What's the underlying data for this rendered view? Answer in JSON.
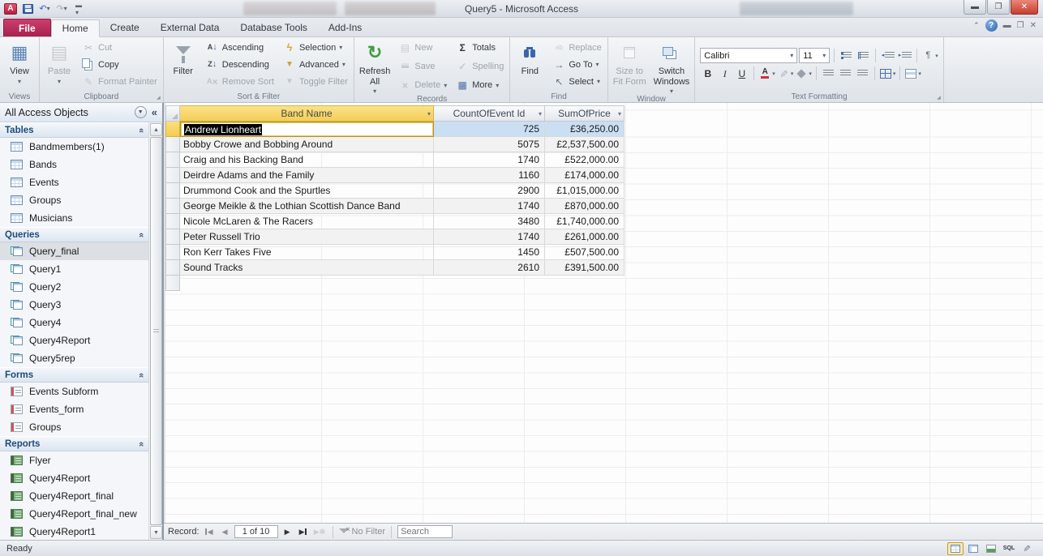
{
  "title_bar": {
    "title": "Query5  -  Microsoft Access",
    "qat_icons": [
      "access",
      "save",
      "undo",
      "redo",
      "customize"
    ],
    "window_controls": [
      "minimize",
      "restore",
      "close"
    ]
  },
  "ribbon": {
    "tabs": [
      {
        "label": "File",
        "file": true
      },
      {
        "label": "Home",
        "active": true
      },
      {
        "label": "Create"
      },
      {
        "label": "External Data"
      },
      {
        "label": "Database Tools"
      },
      {
        "label": "Add-Ins"
      }
    ],
    "groups": [
      {
        "label": "Views",
        "cols": [
          {
            "type": "big",
            "buttons": [
              {
                "label": "View",
                "icon": "view",
                "arrow": true
              }
            ]
          }
        ]
      },
      {
        "label": "Clipboard",
        "dialog": true,
        "cols": [
          {
            "type": "big",
            "buttons": [
              {
                "label": "Paste",
                "icon": "paste",
                "arrow": true,
                "disabled": true
              }
            ]
          },
          {
            "type": "stack",
            "buttons": [
              {
                "label": "Cut",
                "icon": "cut",
                "disabled": true
              },
              {
                "label": "Copy",
                "icon": "copy"
              },
              {
                "label": "Format Painter",
                "icon": "painter",
                "disabled": true
              }
            ]
          }
        ]
      },
      {
        "label": "Sort & Filter",
        "cols": [
          {
            "type": "big",
            "buttons": [
              {
                "label": "Filter",
                "icon": "funnel"
              }
            ]
          },
          {
            "type": "stack",
            "buttons": [
              {
                "label": "Ascending",
                "icon": "asc"
              },
              {
                "label": "Descending",
                "icon": "desc"
              },
              {
                "label": "Remove Sort",
                "icon": "removesort",
                "disabled": true
              }
            ]
          },
          {
            "type": "stack",
            "buttons": [
              {
                "label": "Selection",
                "icon": "selection",
                "arrow": true
              },
              {
                "label": "Advanced",
                "icon": "advanced",
                "arrow": true
              },
              {
                "label": "Toggle Filter",
                "icon": "togglefilter",
                "disabled": true
              }
            ]
          }
        ]
      },
      {
        "label": "Records",
        "cols": [
          {
            "type": "big",
            "buttons": [
              {
                "label": "Refresh\nAll",
                "icon": "refresh",
                "arrow": true
              }
            ]
          },
          {
            "type": "stack",
            "buttons": [
              {
                "label": "New",
                "icon": "new",
                "disabled": true
              },
              {
                "label": "Save",
                "icon": "savesmall",
                "disabled": true
              },
              {
                "label": "Delete",
                "icon": "delete",
                "arrow": true,
                "disabled": true
              }
            ]
          },
          {
            "type": "stack",
            "buttons": [
              {
                "label": "Totals",
                "icon": "totals"
              },
              {
                "label": "Spelling",
                "icon": "spelling",
                "disabled": true
              },
              {
                "label": "More",
                "icon": "more",
                "arrow": true
              }
            ]
          }
        ]
      },
      {
        "label": "Find",
        "cols": [
          {
            "type": "big",
            "buttons": [
              {
                "label": "Find",
                "icon": "find"
              }
            ]
          },
          {
            "type": "stack",
            "buttons": [
              {
                "label": "Replace",
                "icon": "replace",
                "disabled": true
              },
              {
                "label": "Go To",
                "icon": "goto",
                "arrow": true
              },
              {
                "label": "Select",
                "icon": "select",
                "arrow": true
              }
            ]
          }
        ]
      },
      {
        "label": "Window",
        "cols": [
          {
            "type": "big",
            "buttons": [
              {
                "label": "Size to\nFit Form",
                "icon": "sizefit",
                "disabled": true
              },
              {
                "label": "Switch\nWindows",
                "icon": "switchwin",
                "arrow": true
              }
            ]
          }
        ]
      },
      {
        "label": "Text Formatting",
        "dialog": true,
        "cols": [
          {
            "type": "textformat"
          }
        ]
      }
    ]
  },
  "text_formatting": {
    "font_name": "Calibri",
    "font_size": "11",
    "row1_icons": [
      "bullets",
      "numbering",
      "indent-dec",
      "indent-inc",
      "direction"
    ],
    "row2_icons": [
      "bold",
      "italic",
      "underline",
      "font-color",
      "highlight",
      "fill-color",
      "align-left",
      "align-center",
      "align-right",
      "gridlines",
      "alt-row"
    ]
  },
  "nav_pane": {
    "header": "All Access Objects",
    "sections": [
      {
        "title": "Tables",
        "icon": "table",
        "items": [
          "Bandmembers(1)",
          "Bands",
          "Events",
          "Groups",
          "Musicians"
        ]
      },
      {
        "title": "Queries",
        "icon": "query",
        "selected": 0,
        "items": [
          "Query_final",
          "Query1",
          "Query2",
          "Query3",
          "Query4",
          "Query4Report",
          "Query5rep"
        ]
      },
      {
        "title": "Forms",
        "icon": "form",
        "items": [
          "Events Subform",
          "Events_form",
          "Groups"
        ]
      },
      {
        "title": "Reports",
        "icon": "report",
        "items": [
          "Flyer",
          "Query4Report",
          "Query4Report_final",
          "Query4Report_final_new",
          "Query4Report1"
        ]
      }
    ]
  },
  "datasheet": {
    "columns": [
      "Band Name",
      "CountOfEvent Id",
      "SumOfPrice"
    ],
    "selected_row": 0,
    "selected_column": "Band Name",
    "rows": [
      [
        "Andrew Lionheart",
        "725",
        "£36,250.00"
      ],
      [
        "Bobby Crowe and Bobbing Around",
        "5075",
        "£2,537,500.00"
      ],
      [
        "Craig and his Backing Band",
        "1740",
        "£522,000.00"
      ],
      [
        "Deirdre Adams and the Family",
        "1160",
        "£174,000.00"
      ],
      [
        "Drummond Cook and the Spurtles",
        "2900",
        "£1,015,000.00"
      ],
      [
        "George Meikle & the Lothian Scottish Dance Band",
        "1740",
        "£870,000.00"
      ],
      [
        "Nicole McLaren & The Racers",
        "3480",
        "£1,740,000.00"
      ],
      [
        "Peter Russell Trio",
        "1740",
        "£261,000.00"
      ],
      [
        "Ron Kerr Takes Five",
        "1450",
        "£507,500.00"
      ],
      [
        "Sound Tracks",
        "2610",
        "£391,500.00"
      ]
    ]
  },
  "record_nav": {
    "label": "Record:",
    "position": "1 of 10",
    "filter": "No Filter",
    "search": "Search"
  },
  "status_bar": {
    "message": "Ready",
    "views": [
      "datasheet",
      "pivottable",
      "pivotchart",
      "sql",
      "design"
    ],
    "active_view": "datasheet"
  }
}
